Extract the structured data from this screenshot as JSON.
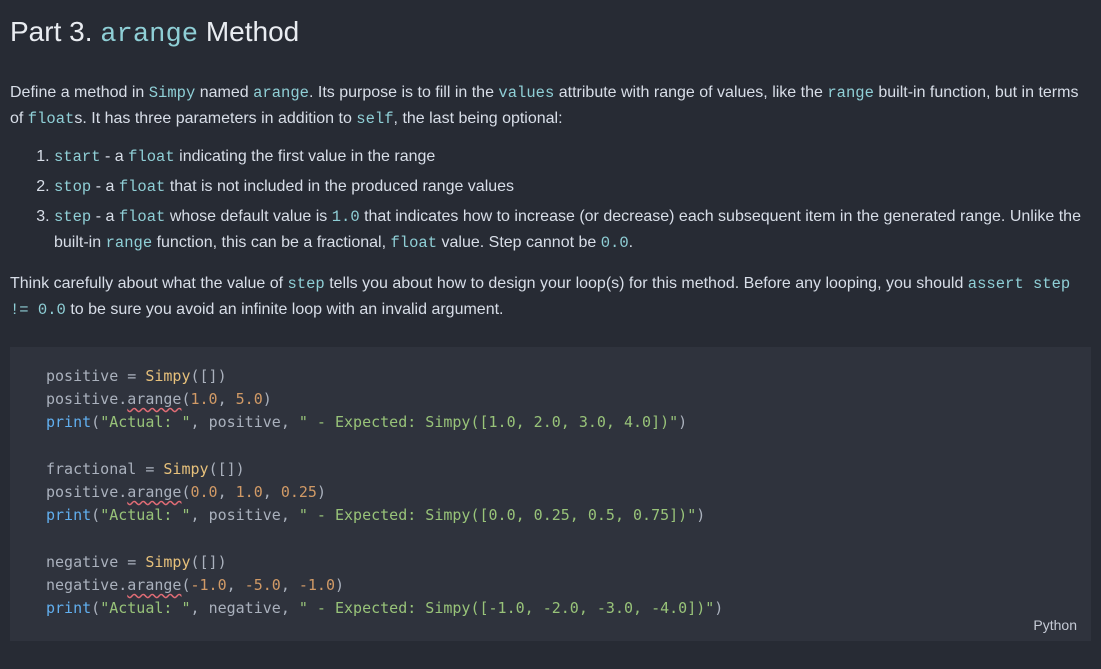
{
  "heading": {
    "pre": "Part 3. ",
    "code": "arange",
    "post": " Method"
  },
  "p1": {
    "t1": "Define a method in ",
    "c1": "Simpy",
    "t2": " named ",
    "c2": "arange",
    "t3": ". Its purpose is to fill in the ",
    "c3": "values",
    "t4": " attribute with range of values, like the ",
    "c4": "range",
    "t5": " built-in function, but in terms of ",
    "c5": "float",
    "t6": "s. It has three parameters in addition to ",
    "c6": "self",
    "t7": ", the last being optional:"
  },
  "li1": {
    "c1": "start",
    "t1": " - a ",
    "c2": "float",
    "t2": " indicating the first value in the range"
  },
  "li2": {
    "c1": "stop",
    "t1": " - a ",
    "c2": "float",
    "t2": " that is not included in the produced range values"
  },
  "li3": {
    "c1": "step",
    "t1": " - a ",
    "c2": "float",
    "t2": " whose default value is ",
    "c3": "1.0",
    "t3": " that indicates how to increase (or decrease) each subsequent item in the generated range. Unlike the built-in ",
    "c4": "range",
    "t4": " function, this can be a fractional, ",
    "c5": "float",
    "t5": " value. Step cannot be ",
    "c6": "0.0",
    "t6": "."
  },
  "p2": {
    "t1": "Think carefully about what the value of ",
    "c1": "step",
    "t2": " tells you about how to design your loop(s) for this method. Before any looping, you should ",
    "c2": "assert step != 0.0",
    "t3": " to be sure you avoid an infinite loop with an invalid argument."
  },
  "code": {
    "lang": "Python",
    "l1": {
      "id1": "positive",
      "op": " = ",
      "cls": "Simpy",
      "p1": "(",
      "p2": "[]",
      "p3": ")"
    },
    "l2": {
      "id1": "positive",
      "dot": ".",
      "attr": "arange",
      "p1": "(",
      "n1": "1.0",
      "c": ", ",
      "n2": "5.0",
      "p2": ")"
    },
    "l3": {
      "fn": "print",
      "p1": "(",
      "s1": "\"Actual: \"",
      "c1": ", ",
      "id": "positive",
      "c2": ", ",
      "s2": "\" - Expected: Simpy([1.0, 2.0, 3.0, 4.0])\"",
      "p2": ")"
    },
    "l5": {
      "id1": "fractional",
      "op": " = ",
      "cls": "Simpy",
      "p1": "(",
      "p2": "[]",
      "p3": ")"
    },
    "l6": {
      "id1": "positive",
      "dot": ".",
      "attr": "arange",
      "p1": "(",
      "n1": "0.0",
      "c1": ", ",
      "n2": "1.0",
      "c2": ", ",
      "n3": "0.25",
      "p2": ")"
    },
    "l7": {
      "fn": "print",
      "p1": "(",
      "s1": "\"Actual: \"",
      "c1": ", ",
      "id": "positive",
      "c2": ", ",
      "s2": "\" - Expected: Simpy([0.0, 0.25, 0.5, 0.75])\"",
      "p2": ")"
    },
    "l9": {
      "id1": "negative",
      "op": " = ",
      "cls": "Simpy",
      "p1": "(",
      "p2": "[]",
      "p3": ")"
    },
    "l10": {
      "id1": "negative",
      "dot": ".",
      "attr": "arange",
      "p1": "(",
      "n1": "-1.0",
      "c1": ", ",
      "n2": "-5.0",
      "c2": ", ",
      "n3": "-1.0",
      "p2": ")"
    },
    "l11": {
      "fn": "print",
      "p1": "(",
      "s1": "\"Actual: \"",
      "c1": ", ",
      "id": "negative",
      "c2": ", ",
      "s2": "\" - Expected: Simpy([-1.0, -2.0, -3.0, -4.0])\"",
      "p2": ")"
    }
  }
}
